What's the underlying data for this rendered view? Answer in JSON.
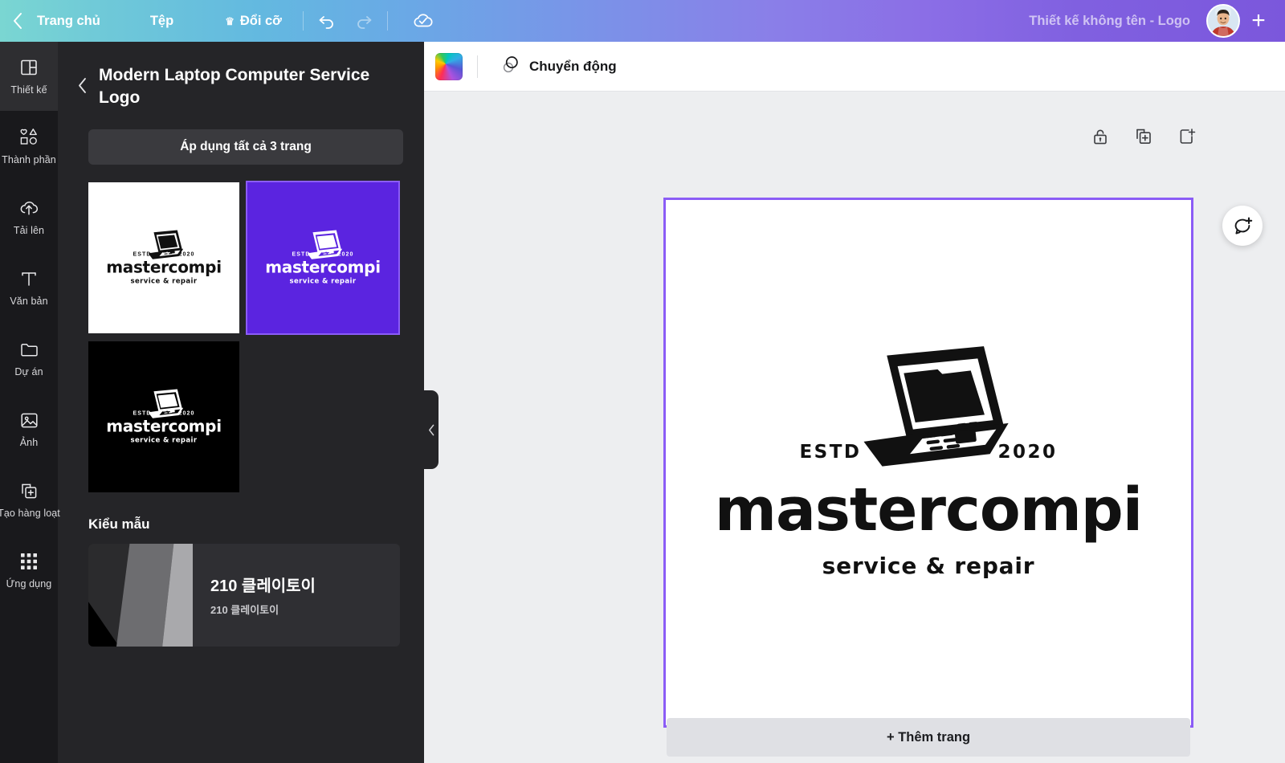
{
  "topbar": {
    "back_icon": "chevron-left-icon",
    "home_label": "Trang chủ",
    "file_label": "Tệp",
    "resize_label": "Đổi cỡ",
    "resize_icon": "crown-icon",
    "undo_icon": "undo-icon",
    "redo_icon": "redo-icon",
    "saved_icon": "cloud-check-icon",
    "doc_title": "Thiết kế không tên - Logo",
    "avatar": "user-avatar",
    "plus_label": "+",
    "gradient_from": "#7ad6d2",
    "gradient_to": "#7b57dc"
  },
  "rail": {
    "items": [
      {
        "label": "Thiết kế",
        "icon": "layout-icon",
        "active": true
      },
      {
        "label": "Thành phần",
        "icon": "shapes-icon",
        "active": false
      },
      {
        "label": "Tải lên",
        "icon": "upload-cloud-icon",
        "active": false
      },
      {
        "label": "Văn bản",
        "icon": "text-t-icon",
        "active": false
      },
      {
        "label": "Dự án",
        "icon": "folder-icon",
        "active": false
      },
      {
        "label": "Ảnh",
        "icon": "image-icon",
        "active": false
      },
      {
        "label": "Tạo hàng loạt",
        "icon": "bulk-create-icon",
        "active": false
      },
      {
        "label": "Ứng dụng",
        "icon": "grid-apps-icon",
        "active": false
      }
    ]
  },
  "panel": {
    "back_icon": "chevron-left-icon",
    "title": "Modern Laptop Computer Service Logo",
    "apply_label": "Áp dụng tất cả 3 trang",
    "thumbnails": [
      {
        "name": "white-variant",
        "bg": "#ffffff",
        "ink": "#111111",
        "selected": false
      },
      {
        "name": "purple-variant",
        "bg": "#5b24e0",
        "ink": "#ffffff",
        "selected": true
      },
      {
        "name": "black-variant",
        "bg": "#000000",
        "ink": "#ffffff",
        "selected": false
      }
    ],
    "styles_section_label": "Kiểu mẫu",
    "style_card": {
      "name": "210 클레이토이",
      "sub": "210 클레이토이"
    },
    "collapse_icon": "chevron-left-icon"
  },
  "editor": {
    "color_swatch": "rainbow-color-swatch",
    "motion_label": "Chuyển động",
    "motion_icon": "animate-circles-icon",
    "page_tools": [
      {
        "name": "lock-icon"
      },
      {
        "name": "duplicate-page-icon"
      },
      {
        "name": "add-page-icon"
      }
    ],
    "comment_icon": "add-comment-icon",
    "add_page_label": "+ Thêm trang",
    "canvas_border_color": "#8b5cf6"
  },
  "logo": {
    "estd": "ESTD",
    "year": "2020",
    "name": "mastercompi",
    "tagline": "service & repair",
    "icon": "laptop-icon"
  }
}
